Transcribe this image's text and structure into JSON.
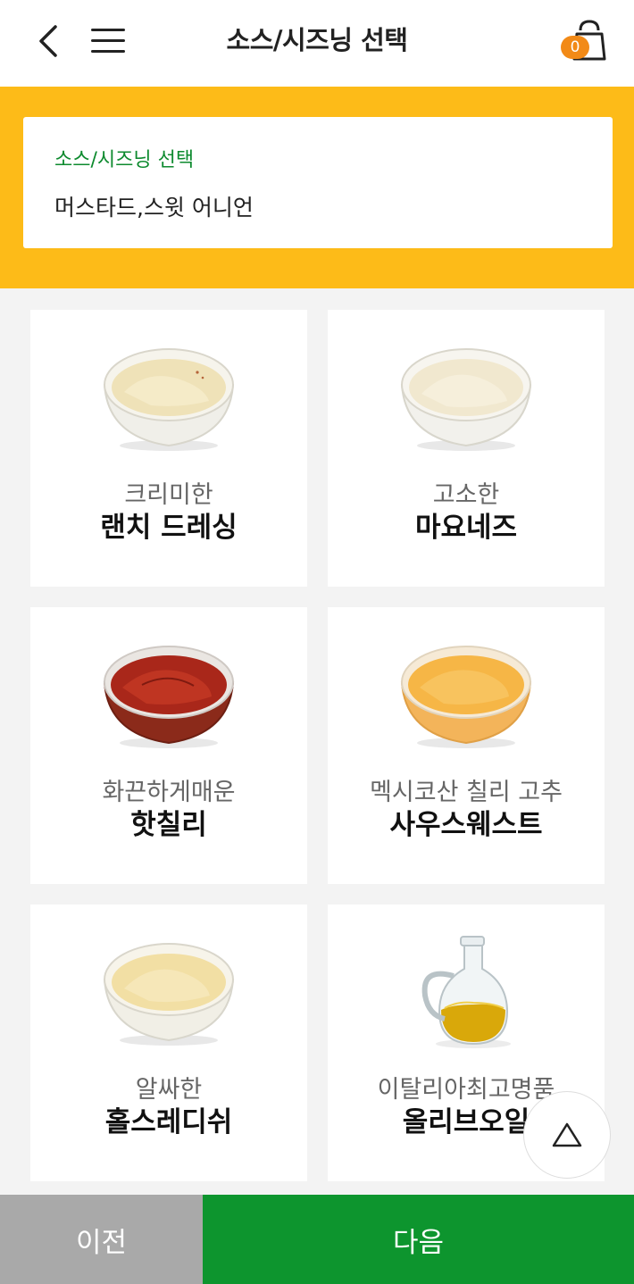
{
  "header": {
    "title": "소스/시즈닝 선택",
    "cart_count": "0",
    "back_icon": "chevron-left-icon",
    "menu_icon": "hamburger-icon",
    "cart_icon": "shopping-bag-icon"
  },
  "selection": {
    "label": "소스/시즈닝 선택",
    "value": "머스타드,스윗 어니언"
  },
  "items": [
    {
      "desc": "크리미한",
      "name": "랜치 드레싱"
    },
    {
      "desc": "고소한",
      "name": "마요네즈"
    },
    {
      "desc": "화끈하게매운",
      "name": "핫칠리"
    },
    {
      "desc": "멕시코산 칠리 고추",
      "name": "사우스웨스트"
    },
    {
      "desc": "알싸한",
      "name": "홀스레디쉬"
    },
    {
      "desc": "이탈리아최고명품",
      "name": "올리브오일"
    }
  ],
  "footer": {
    "prev_label": "이전",
    "next_label": "다음"
  },
  "colors": {
    "brand_yellow": "#fdbb18",
    "brand_green": "#0d952e",
    "badge_orange": "#f28a17"
  }
}
